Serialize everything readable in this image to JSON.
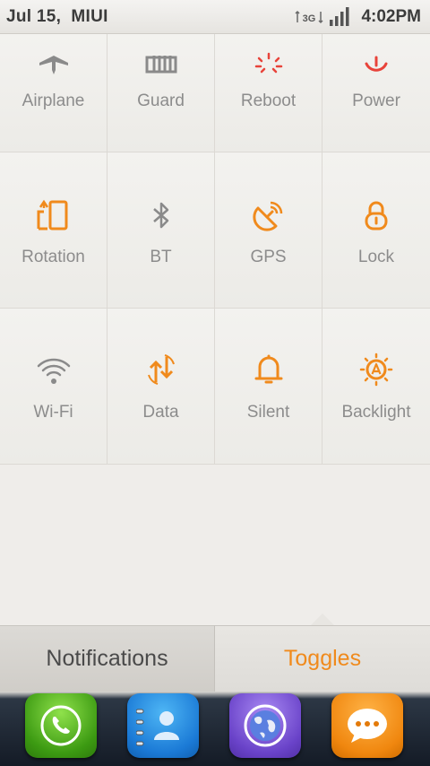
{
  "status_bar": {
    "left_text": "Jul 15,  MIUI",
    "network_type": "3G",
    "network_icon": "3g-data-icon",
    "signal_icon": "cell-signal-icon",
    "time": "4:02PM"
  },
  "toggles": {
    "row1": [
      {
        "label": "Airplane",
        "icon": "airplane-icon",
        "active": false
      },
      {
        "label": "Guard",
        "icon": "guard-icon",
        "active": false
      },
      {
        "label": "Reboot",
        "icon": "reboot-icon",
        "active": false
      },
      {
        "label": "Power",
        "icon": "power-icon",
        "active": false
      }
    ],
    "row2": [
      {
        "label": "Rotation",
        "icon": "rotation-icon",
        "active": true
      },
      {
        "label": "BT",
        "icon": "bluetooth-icon",
        "active": false
      },
      {
        "label": "GPS",
        "icon": "gps-icon",
        "active": true
      },
      {
        "label": "Lock",
        "icon": "lock-icon",
        "active": true
      }
    ],
    "row3": [
      {
        "label": "Wi-Fi",
        "icon": "wifi-icon",
        "active": false
      },
      {
        "label": "Data",
        "icon": "data-icon",
        "active": true
      },
      {
        "label": "Silent",
        "icon": "bell-icon",
        "active": true
      },
      {
        "label": "Backlight",
        "icon": "backlight-icon",
        "active": true
      }
    ]
  },
  "tabs": {
    "notifications": "Notifications",
    "toggles": "Toggles",
    "selected": "toggles"
  },
  "dock": {
    "apps": [
      {
        "name": "phone",
        "icon": "phone-icon"
      },
      {
        "name": "contacts",
        "icon": "contacts-icon"
      },
      {
        "name": "browser",
        "icon": "globe-icon"
      },
      {
        "name": "messages",
        "icon": "message-bubble-icon"
      }
    ]
  },
  "colors": {
    "active": "#f08a1c",
    "inactive": "#8a8a8a",
    "reboot_red": "#e8433a",
    "label": "#8c8c8c",
    "background": "#efedea"
  }
}
